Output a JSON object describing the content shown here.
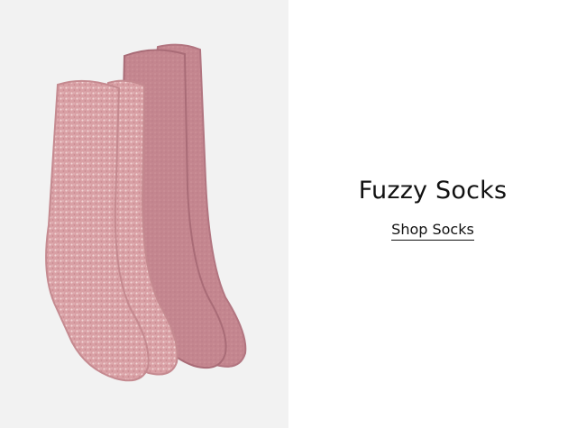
{
  "promo": {
    "headline": "Fuzzy Socks",
    "link_label": "Shop Socks"
  },
  "image": {
    "subject": "socks-image",
    "colors": {
      "background": "#f2f2f2",
      "heather_pink": "#d79ea3",
      "heather_light": "#ecc8c9",
      "mauve": "#c4868f",
      "mauve_dark": "#b27580"
    }
  }
}
